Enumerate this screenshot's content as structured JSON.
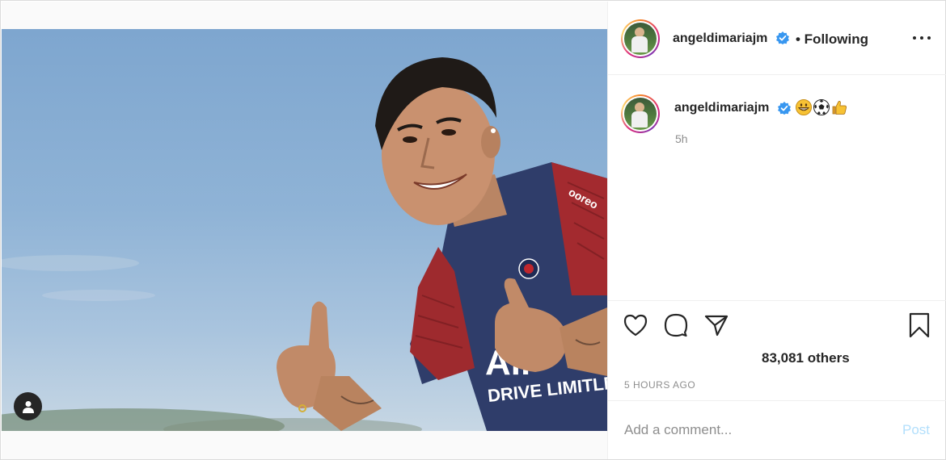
{
  "post": {
    "author": {
      "username": "angeldimariajm",
      "verified": true,
      "follow_status": "• Following"
    },
    "caption": {
      "username": "angeldimariajm",
      "emojis": [
        "grinning-face",
        "soccer-ball",
        "thumbs-up"
      ]
    },
    "time_ago": "5h",
    "likes": "83,081 others",
    "date": "5 HOURS AGO",
    "comment": {
      "placeholder": "Add a comment...",
      "value": "",
      "post_label": "Post"
    },
    "colors": {
      "verified_blue": "#3897f0",
      "post_button": "#b2dffc",
      "text_primary": "#262626",
      "text_secondary": "#8e8e8e"
    },
    "icons": [
      "heart-icon",
      "comment-icon",
      "share-icon",
      "bookmark-icon",
      "more-options-icon",
      "user-tag-icon",
      "verified-badge-icon"
    ]
  }
}
